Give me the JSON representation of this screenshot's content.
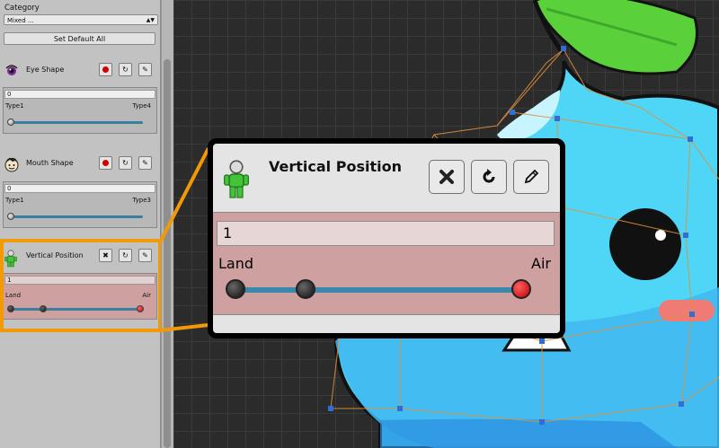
{
  "category": {
    "label": "Category",
    "selected": "Mixed ..."
  },
  "set_default_all_label": "Set Default All",
  "controls": [
    {
      "title": "Eye Shape",
      "icon": "eye-icon",
      "value": "0",
      "min_label": "Type1",
      "max_label": "Type4",
      "slider_fraction": 0.0,
      "active": false
    },
    {
      "title": "Mouth Shape",
      "icon": "face-icon",
      "value": "0",
      "min_label": "Type1",
      "max_label": "Type3",
      "slider_fraction": 0.0,
      "active": false
    },
    {
      "title": "Vertical Position",
      "icon": "character-icon",
      "value": "1",
      "min_label": "Land",
      "max_label": "Air",
      "slider_fraction": 1.0,
      "active": true
    }
  ],
  "zoom_callout": {
    "title": "Vertical Position",
    "value": "1",
    "min_label": "Land",
    "max_label": "Air",
    "icon": "character-icon",
    "buttons": [
      "close-icon",
      "reset-icon",
      "edit-icon"
    ]
  },
  "colors": {
    "highlight": "#f29a05",
    "active_panel": "#cfa0a0",
    "slider_track": "#3b88ad",
    "character_body": "#4fd6f6",
    "leaf": "#5ad13a",
    "cheek": "#f07a74",
    "mesh_line": "#e0903a",
    "mesh_vertex": "#2d6fd8"
  }
}
